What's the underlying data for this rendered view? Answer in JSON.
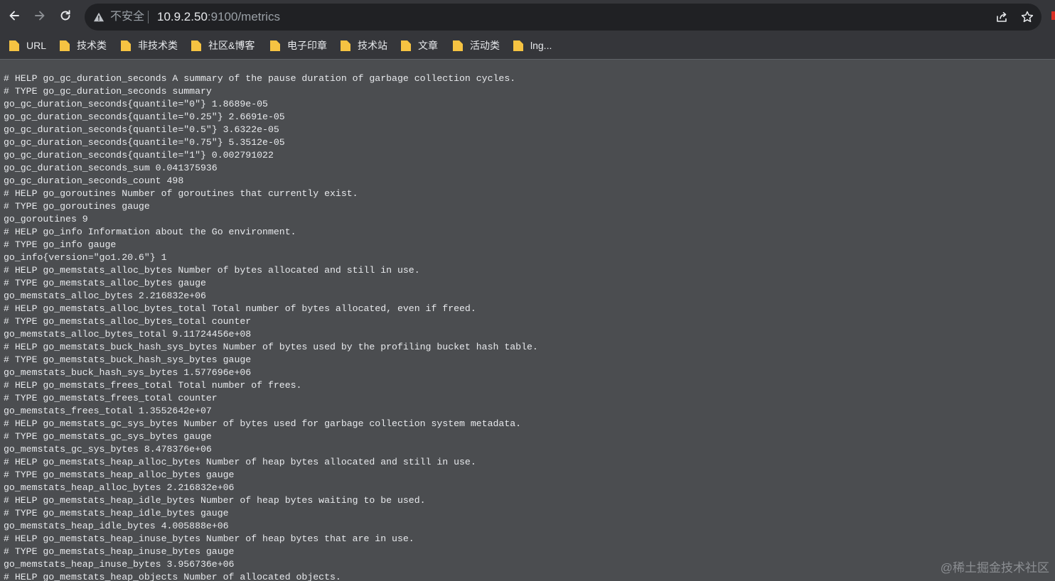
{
  "browser": {
    "security_label": "不安全",
    "url_host": "10.9.2.50",
    "url_rest": ":9100/metrics",
    "icons": {
      "back": "arrow-left-icon",
      "forward": "arrow-right-icon",
      "reload": "reload-icon",
      "security": "warning-triangle-icon",
      "share": "share-icon",
      "bookmark": "star-icon",
      "folder": "folder-icon"
    },
    "colors": {
      "folder": "#f6c342",
      "warning": "#d93025"
    }
  },
  "bookmarks": [
    {
      "label": "URL"
    },
    {
      "label": "技术类"
    },
    {
      "label": "非技术类"
    },
    {
      "label": "社区&博客"
    },
    {
      "label": "电子印章"
    },
    {
      "label": "技术站"
    },
    {
      "label": "文章"
    },
    {
      "label": "活动类"
    },
    {
      "label": "lng..."
    }
  ],
  "page": {
    "lines": [
      "# HELP go_gc_duration_seconds A summary of the pause duration of garbage collection cycles.",
      "# TYPE go_gc_duration_seconds summary",
      "go_gc_duration_seconds{quantile=\"0\"} 1.8689e-05",
      "go_gc_duration_seconds{quantile=\"0.25\"} 2.6691e-05",
      "go_gc_duration_seconds{quantile=\"0.5\"} 3.6322e-05",
      "go_gc_duration_seconds{quantile=\"0.75\"} 5.3512e-05",
      "go_gc_duration_seconds{quantile=\"1\"} 0.002791022",
      "go_gc_duration_seconds_sum 0.041375936",
      "go_gc_duration_seconds_count 498",
      "# HELP go_goroutines Number of goroutines that currently exist.",
      "# TYPE go_goroutines gauge",
      "go_goroutines 9",
      "# HELP go_info Information about the Go environment.",
      "# TYPE go_info gauge",
      "go_info{version=\"go1.20.6\"} 1",
      "# HELP go_memstats_alloc_bytes Number of bytes allocated and still in use.",
      "# TYPE go_memstats_alloc_bytes gauge",
      "go_memstats_alloc_bytes 2.216832e+06",
      "# HELP go_memstats_alloc_bytes_total Total number of bytes allocated, even if freed.",
      "# TYPE go_memstats_alloc_bytes_total counter",
      "go_memstats_alloc_bytes_total 9.11724456e+08",
      "# HELP go_memstats_buck_hash_sys_bytes Number of bytes used by the profiling bucket hash table.",
      "# TYPE go_memstats_buck_hash_sys_bytes gauge",
      "go_memstats_buck_hash_sys_bytes 1.577696e+06",
      "# HELP go_memstats_frees_total Total number of frees.",
      "# TYPE go_memstats_frees_total counter",
      "go_memstats_frees_total 1.3552642e+07",
      "# HELP go_memstats_gc_sys_bytes Number of bytes used for garbage collection system metadata.",
      "# TYPE go_memstats_gc_sys_bytes gauge",
      "go_memstats_gc_sys_bytes 8.478376e+06",
      "# HELP go_memstats_heap_alloc_bytes Number of heap bytes allocated and still in use.",
      "# TYPE go_memstats_heap_alloc_bytes gauge",
      "go_memstats_heap_alloc_bytes 2.216832e+06",
      "# HELP go_memstats_heap_idle_bytes Number of heap bytes waiting to be used.",
      "# TYPE go_memstats_heap_idle_bytes gauge",
      "go_memstats_heap_idle_bytes 4.005888e+06",
      "# HELP go_memstats_heap_inuse_bytes Number of heap bytes that are in use.",
      "# TYPE go_memstats_heap_inuse_bytes gauge",
      "go_memstats_heap_inuse_bytes 3.956736e+06",
      "# HELP go_memstats_heap_objects Number of allocated objects."
    ],
    "watermark": "@稀土掘金技术社区"
  }
}
